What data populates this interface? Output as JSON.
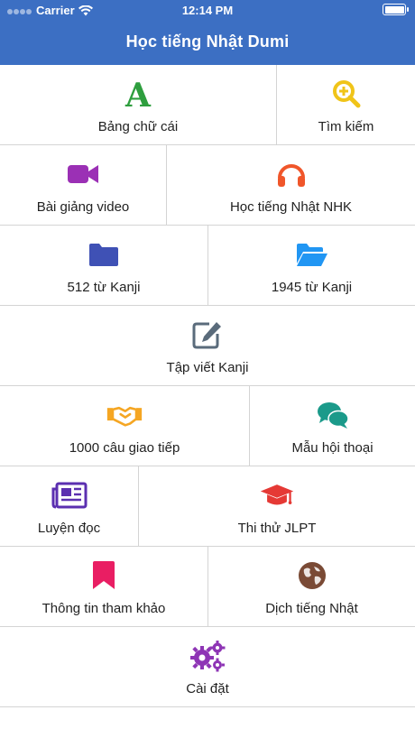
{
  "status": {
    "carrier": "Carrier",
    "time": "12:14 PM"
  },
  "header": {
    "title": "Học tiếng Nhật Dumi"
  },
  "menu": [
    {
      "label": "Bảng chữ cái",
      "icon": "alphabet-a-icon",
      "color": "#2e9e3e"
    },
    {
      "label": "Tìm kiếm",
      "icon": "zoom-in-icon",
      "color": "#f0c419"
    },
    {
      "label": "Bài giảng video",
      "icon": "video-camera-icon",
      "color": "#9b30b5"
    },
    {
      "label": "Học tiếng Nhật NHK",
      "icon": "headphones-icon",
      "color": "#f0562a"
    },
    {
      "label": "512 từ Kanji",
      "icon": "folder-icon",
      "color": "#3f51b5"
    },
    {
      "label": "1945 từ Kanji",
      "icon": "folder-open-icon",
      "color": "#2196f3"
    },
    {
      "label": "Tập viết Kanji",
      "icon": "edit-icon",
      "color": "#5a6b7b"
    },
    {
      "label": "1000 câu giao tiếp",
      "icon": "handshake-icon",
      "color": "#f5a623"
    },
    {
      "label": "Mẫu hội thoại",
      "icon": "chat-bubbles-icon",
      "color": "#1b9a8a"
    },
    {
      "label": "Luyện đọc",
      "icon": "newspaper-icon",
      "color": "#5b2fb0"
    },
    {
      "label": "Thi thử JLPT",
      "icon": "graduation-cap-icon",
      "color": "#e53935"
    },
    {
      "label": "Thông tin tham khảo",
      "icon": "bookmark-icon",
      "color": "#e91e63"
    },
    {
      "label": "Dịch tiếng Nhật",
      "icon": "globe-icon",
      "color": "#7a4a35"
    },
    {
      "label": "Cài đặt",
      "icon": "gears-icon",
      "color": "#8e35b5"
    }
  ]
}
